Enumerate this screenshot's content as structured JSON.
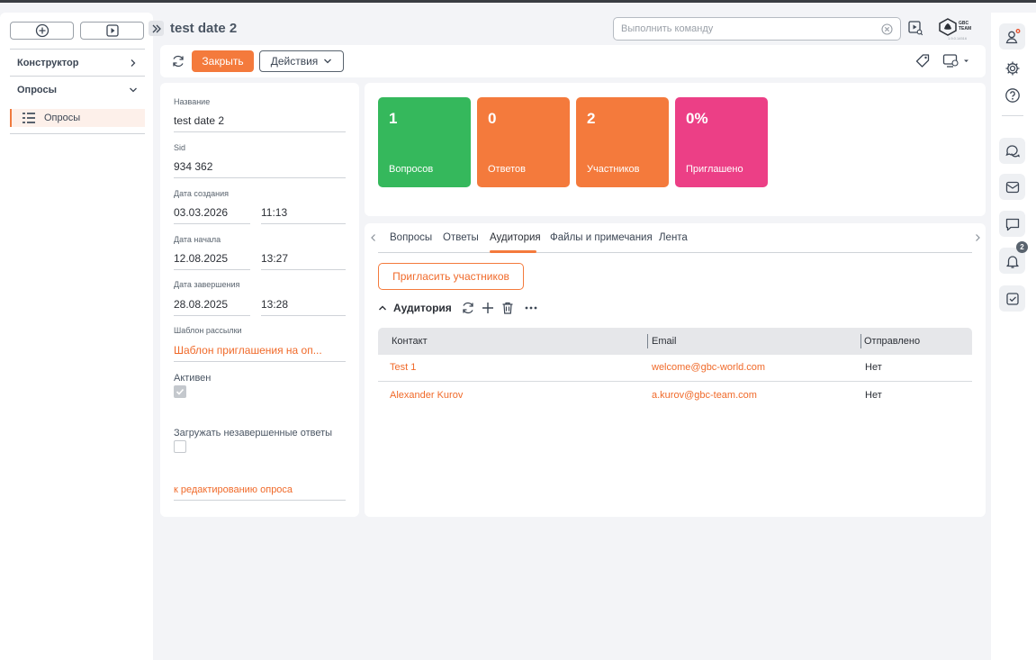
{
  "header": {
    "title": "test date 2",
    "command_placeholder": "Выполнить команду",
    "logo_text_line1": "GBC",
    "logo_text_line2": "TEAM",
    "logo_version": "1.9.0.14516"
  },
  "sidebar": {
    "sections": [
      {
        "label": "Конструктор"
      },
      {
        "label": "Опросы"
      }
    ],
    "items": [
      {
        "label": "Опросы"
      }
    ]
  },
  "toolbar": {
    "close_label": "Закрыть",
    "actions_label": "Действия"
  },
  "form": {
    "name_label": "Название",
    "name_value": "test date 2",
    "sid_label": "Sid",
    "sid_value": "934 362",
    "created_label": "Дата создания",
    "created_date": "03.03.2026",
    "created_time": "11:13",
    "start_label": "Дата начала",
    "start_date": "12.08.2025",
    "start_time": "13:27",
    "end_label": "Дата завершения",
    "end_date": "28.08.2025",
    "end_time": "13:28",
    "template_label": "Шаблон рассылки",
    "template_value": "Шаблон приглашения на оп...",
    "active_label": "Активен",
    "active_checked": true,
    "load_unfinished_label": "Загружать незавершенные ответы",
    "load_unfinished_checked": false,
    "edit_link": "к редактированию опроса"
  },
  "stats": [
    {
      "value": "1",
      "label": "Вопросов",
      "color": "#35b85c"
    },
    {
      "value": "0",
      "label": "Ответов",
      "color": "#f47a3c"
    },
    {
      "value": "2",
      "label": "Участников",
      "color": "#f47a3c"
    },
    {
      "value": "0%",
      "label": "Приглашено",
      "color": "#ec3f86"
    }
  ],
  "tabs": [
    {
      "label": "Вопросы",
      "active": false
    },
    {
      "label": "Ответы",
      "active": false
    },
    {
      "label": "Аудитория",
      "active": true
    },
    {
      "label": "Файлы и примечания",
      "active": false
    },
    {
      "label": "Лента",
      "active": false
    }
  ],
  "audience": {
    "invite_label": "Пригласить участников",
    "section_title": "Аудитория",
    "columns": [
      "Контакт",
      "Email",
      "Отправлено"
    ],
    "rows": [
      {
        "contact": "Test 1",
        "email": "welcome@gbc-world.com",
        "sent": "Нет"
      },
      {
        "contact": "Alexander Kurov",
        "email": "a.kurov@gbc-team.com",
        "sent": "Нет"
      }
    ]
  },
  "rail": {
    "notification_count": "2"
  },
  "colors": {
    "accent": "#f47a3c",
    "link": "#f06a2a",
    "green": "#35b85c",
    "pink": "#ec3f86"
  }
}
